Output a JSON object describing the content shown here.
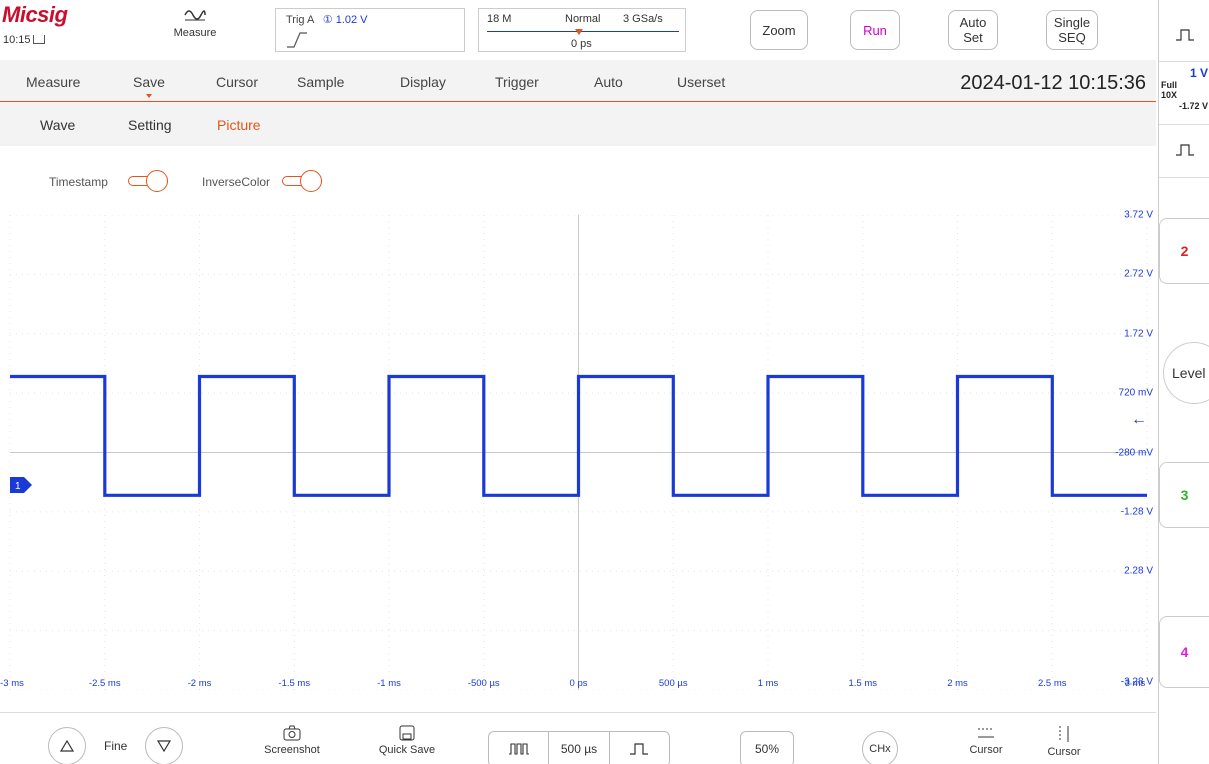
{
  "header": {
    "logo": "Micsig",
    "clock": "10:15",
    "measure_label": "Measure",
    "trigger": {
      "label": "Trig A",
      "level": "① 1.02 V"
    },
    "acquisition": {
      "memory": "18 M",
      "mode": "Normal",
      "sample_rate": "3 GSa/s",
      "position": "0 ps"
    },
    "buttons": {
      "zoom": "Zoom",
      "run": "Run",
      "auto_set_l1": "Auto",
      "auto_set_l2": "Set",
      "single_l1": "Single",
      "single_l2": "SEQ"
    }
  },
  "menu": {
    "items": [
      "Measure",
      "Save",
      "Cursor",
      "Sample",
      "Display",
      "Trigger",
      "Auto",
      "Userset"
    ],
    "active": "Save",
    "datetime": "2024-01-12 10:15:36",
    "sub_items": [
      "Wave",
      "Setting",
      "Picture"
    ],
    "sub_active": "Picture",
    "options": {
      "timestamp": "Timestamp",
      "inverse_color": "InverseColor"
    }
  },
  "channel1": {
    "scale": "1 V",
    "coupling": "Full",
    "probe": "10X",
    "offset": "-1.72 V",
    "marker": "1"
  },
  "right_panel": {
    "ch2": "2",
    "level": "Level",
    "ch3": "3",
    "ch4": "4"
  },
  "scope": {
    "volt_labels": [
      "3.72 V",
      "2.72 V",
      "1.72 V",
      "720 mV",
      "-280 mV",
      "-1.28 V",
      "2.28 V",
      "-3.28 V"
    ],
    "time_labels": [
      "-3 ms",
      "-2.5 ms",
      "-2 ms",
      "-1.5 ms",
      "-1 ms",
      "-500 µs",
      "0 ps",
      "500 µs",
      "1 ms",
      "1.5 ms",
      "2 ms",
      "2.5 ms",
      "3 ms"
    ]
  },
  "bottom": {
    "fine": "Fine",
    "screenshot": "Screenshot",
    "quick_save": "Quick Save",
    "timebase": "500 µs",
    "fifty_percent": "50%",
    "chx": "CHx",
    "cursor1": "Cursor",
    "cursor2": "Cursor"
  },
  "chart_data": {
    "type": "line",
    "x_unit": "ms",
    "y_unit": "V",
    "xlim": [
      -3,
      3
    ],
    "ylim": [
      -3.28,
      4.72
    ],
    "series": [
      {
        "x": [
          -3,
          -2.5,
          -2.5,
          -2,
          -2,
          -1.5,
          -1.5,
          -1,
          -1,
          -0.5,
          -0.5,
          0,
          0,
          0.5,
          0.5,
          1,
          1,
          1.5,
          1.5,
          2,
          2,
          2.5,
          2.5,
          3
        ],
        "y": [
          2.0,
          2.0,
          0.0,
          0.0,
          2.0,
          2.0,
          0.0,
          0.0,
          2.0,
          2.0,
          0.0,
          0.0,
          2.0,
          2.0,
          0.0,
          0.0,
          2.0,
          2.0,
          0.0,
          0.0,
          2.0,
          2.0,
          0.0,
          0.0
        ],
        "color": "#1a3ad8"
      }
    ]
  }
}
